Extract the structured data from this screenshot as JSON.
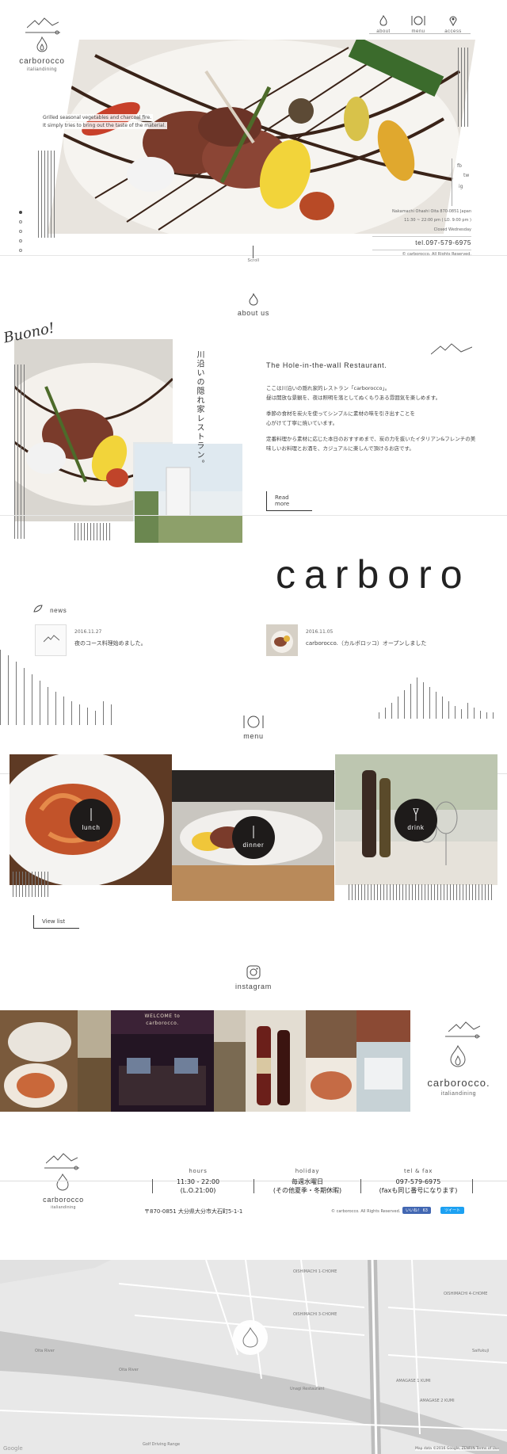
{
  "header": {
    "brand_name": "carborocco",
    "brand_sub": "italiandining",
    "nav": [
      {
        "label": "about",
        "icon": "flame-icon"
      },
      {
        "label": "menu",
        "icon": "fork-knife-icon"
      },
      {
        "label": "access",
        "icon": "pin-icon"
      }
    ],
    "social": [
      "fb",
      "tw",
      "ig"
    ]
  },
  "hero": {
    "caption_line1": "Grilled seasonal vegetables and charcoal fire.",
    "caption_line2": "It simply tries to bring out the taste of the material.",
    "address": "Nakamachi Ohashi Oita 870-0851 Japan",
    "hours": "11:30 ~ 22:00 pm ( LO. 9:00 pm )",
    "closed": "Closed Wednesday",
    "tel": "tel.097-579-6975",
    "copyright": "© carborocco, All Rights Reserved.",
    "scroll_label": "Scroll"
  },
  "about": {
    "heading": "about us",
    "buono": "Buono!",
    "vertical_copy": "川沿いの隠れ家レストラン。",
    "title": "The Hole-in-the-wall Restaurant.",
    "para1_line1": "ここは川沿いの隠れ家的レストラン「carborocco」。",
    "para1_line2": "昼は開放な景観を、夜は照明を落としてぬくもりある雰囲気を楽しめます。",
    "para2_line1": "季節の食材を炭火を使ってシンプルに素材の味を引き出すことを",
    "para2_line2": "心がけて丁寧に焼いています。",
    "para3_line1": "定番料理から素材に応じた本日のおすすめまで、炭の力を抜いたイタリアン&フレンチの美",
    "para3_line2": "味しいお料理とお酒を、カジュアルに楽しんで頂けるお店です。",
    "read_more": "Read more"
  },
  "big_word": "carboro",
  "news": {
    "heading": "news",
    "items": [
      {
        "date": "2016.11.27",
        "title": "夜のコース料理始めました。"
      },
      {
        "date": "2016.11.05",
        "title": "carborocco.（カルボロッコ）オープンしました"
      }
    ]
  },
  "menu": {
    "heading": "menu",
    "items": [
      {
        "label": "lunch"
      },
      {
        "label": "dinner"
      },
      {
        "label": "drink"
      }
    ],
    "view_list": "View list"
  },
  "instagram": {
    "heading": "instagram",
    "sign_lines": [
      "WELCOME to",
      "carborocco."
    ],
    "brand_name": "carborocco.",
    "brand_sub": "italiandining"
  },
  "footer": {
    "brand_name": "carborocco",
    "brand_sub": "italiandining",
    "hours_label": "hours",
    "hours_value": "11:30 - 22:00",
    "hours_sub": "(L.O.21:00)",
    "holiday_label": "holiday",
    "holiday_value": "毎週水曜日",
    "holiday_sub": "(その他夏季・冬期休暇)",
    "tel_label": "tel & fax",
    "tel_value": "097-579-6975",
    "tel_sub": "(faxも同じ番号になります)",
    "address": "〒870-0851 大分県大分市大石町5-1-1",
    "copyright": "© carborocco. All Rights Reserved.",
    "like_label": "いいね！ 63",
    "tweet_label": "ツイート"
  },
  "map": {
    "labels": [
      "Oita River",
      "Oita River",
      "Unagi Restaurant",
      "Golf Driving Range",
      "OISHIMACHI 1-CHOME",
      "OISHIMACHI 3-CHOME",
      "OISHIMACHI 4-CHOME",
      "AMAGASE 1 KUMI",
      "AMAGASE 2 KUMI",
      "Saifukuji",
      "Google"
    ],
    "attribution": "Map data ©2016 Google, ZENRIN   Terms of Use"
  },
  "colors": {
    "dark": "#1e1b1a",
    "accent_blue": "#3b5998",
    "twitter": "#1da1f2"
  }
}
